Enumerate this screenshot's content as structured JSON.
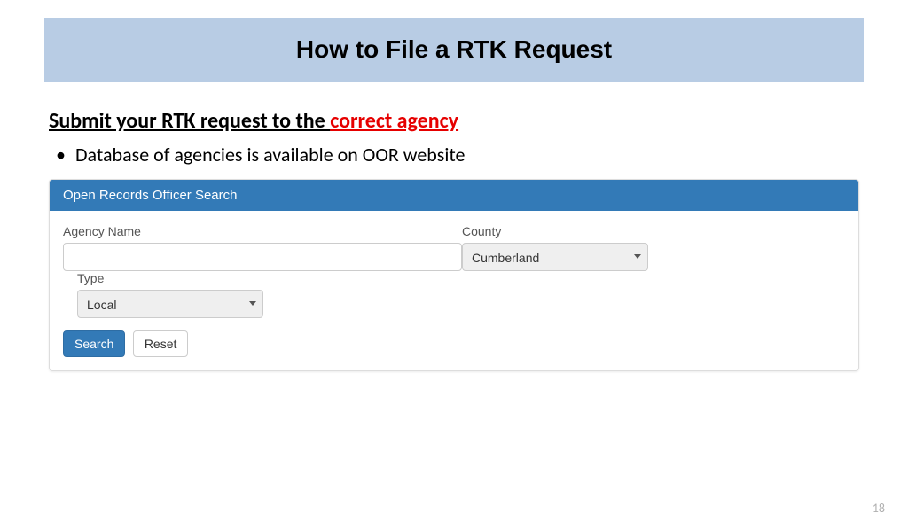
{
  "title": "How to File a RTK Request",
  "subheading": {
    "prefix": "Submit your RTK request to the ",
    "highlight": "correct agency"
  },
  "bullet": "Database of agencies is available on OOR website",
  "search_panel": {
    "header": "Open Records Officer Search",
    "agency_label": "Agency Name",
    "agency_value": "",
    "county_label": "County",
    "county_value": "Cumberland",
    "type_label": "Type",
    "type_value": "Local",
    "search_button": "Search",
    "reset_button": "Reset"
  },
  "page_number": "18"
}
